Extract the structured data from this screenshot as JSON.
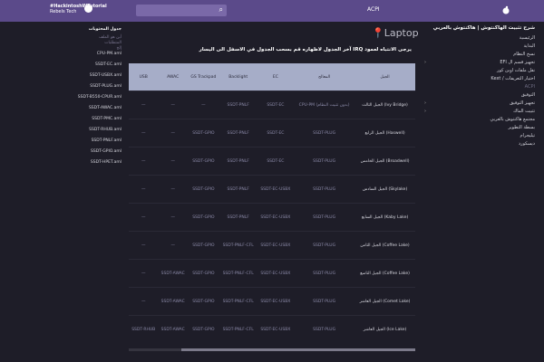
{
  "brand": {
    "line1": "#HackintoshWTutorial",
    "line2": "Rebels Tech"
  },
  "acpi": "ACPI",
  "toc": {
    "title": "جدول المحتويات",
    "items_dim": [
      "أين هو الملف",
      "المتطلبات",
      "إلخ"
    ],
    "items": [
      "CPU-PM.aml",
      "SSDT-EC.aml",
      "SSDT-USBX.aml",
      "SSDT-PLUG.aml",
      "SSDT-B550-CPUR.aml",
      "SSDT-AWAC.aml",
      "SSDT-PMC.aml",
      "SSDT-RHUB.aml",
      "SSDT-PNLF.aml",
      "SSDT-GPIO.aml",
      "SSDT-HPET.aml"
    ]
  },
  "nav": {
    "title": "شرح تثبيت الهاكنتوش | هاكنتوش بالعربي",
    "items": [
      {
        "label": "الرئيسية"
      },
      {
        "label": "البداية"
      },
      {
        "label": "نسخ النظام"
      },
      {
        "label": "تجهيز قسم ال EFI",
        "chev": true
      },
      {
        "label": "نقل ملفات اوبن كور"
      },
      {
        "label": "اختيار التعريفات / Kext"
      },
      {
        "label": "ACPI",
        "dim": true
      },
      {
        "label": "التوفيق"
      },
      {
        "label": "تجهيز التوفيق",
        "chev": true
      },
      {
        "label": "تثبيت الماك",
        "chev": true
      },
      {
        "label": "مجتمع هاكنتوش بالعربي"
      },
      {
        "label": "بسطة التطوير"
      },
      {
        "label": "تيليجرام"
      },
      {
        "label": "ديسكورد"
      }
    ]
  },
  "page": {
    "title": "Laptop",
    "intro": "يرجى الانتباه لعمود IRQ آخر الجدول لاظهاره قم بسحب الجدول في الاسفل الى اليسار"
  },
  "table": {
    "headers": [
      "USB",
      "AWAC",
      "GS Trackpad",
      "Backlight",
      "EC",
      "المعالج",
      "الجيل"
    ],
    "rows": [
      [
        "—",
        "—",
        "—",
        "SSDT-PNLF",
        "SSDT-EC",
        "CPU-PM (بدون تثبيت النظام)",
        "الجيل الثالث (Ivy Bridge)"
      ],
      [
        "—",
        "—",
        "SSDT-GPIO",
        "SSDT-PNLF",
        "SSDT-EC",
        "SSDT-PLUG",
        "الجيل الرابع (Haswell)"
      ],
      [
        "—",
        "—",
        "SSDT-GPIO",
        "SSDT-PNLF",
        "SSDT-EC",
        "SSDT-PLUG",
        "الجيل الخامس (Broadwell)"
      ],
      [
        "—",
        "—",
        "SSDT-GPIO",
        "SSDT-PNLF",
        "SSDT-EC-USBX",
        "SSDT-PLUG",
        "الجيل السادس (Skylake)"
      ],
      [
        "—",
        "—",
        "SSDT-GPIO",
        "SSDT-PNLF",
        "SSDT-EC-USBX",
        "SSDT-PLUG",
        "الجيل السابع (Kaby Lake)"
      ],
      [
        "—",
        "—",
        "SSDT-GPIO",
        "SSDT-PNLF-CFL",
        "SSDT-EC-USBX",
        "SSDT-PLUG",
        "الجيل الثامن (Coffee Lake)"
      ],
      [
        "—",
        "SSDT-AWAC",
        "SSDT-GPIO",
        "SSDT-PNLF-CFL",
        "SSDT-EC-USBX",
        "SSDT-PLUG",
        "الجيل التاسع (Coffee Lake)"
      ],
      [
        "—",
        "SSDT-AWAC",
        "SSDT-GPIO",
        "SSDT-PNLF-CFL",
        "SSDT-EC-USBX",
        "SSDT-PLUG",
        "الجيل العاشر (Comet Lake)"
      ],
      [
        "SSDT-RHUB",
        "SSDT-AWAC",
        "SSDT-GPIO",
        "SSDT-PNLF-CFL",
        "SSDT-EC-USBX",
        "SSDT-PLUG",
        "الجيل العاشر (Ice Lake)"
      ]
    ]
  }
}
